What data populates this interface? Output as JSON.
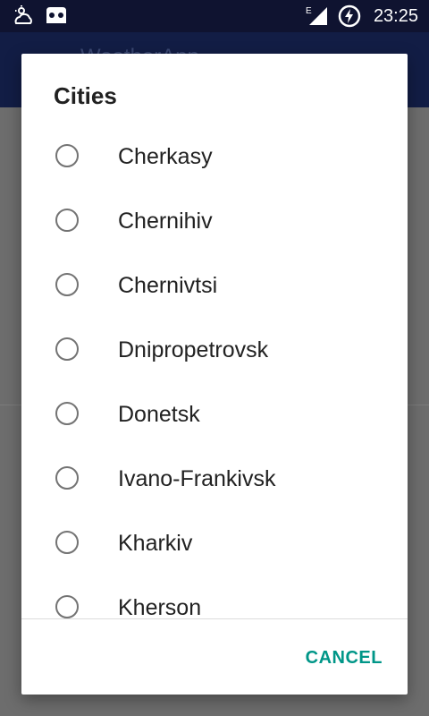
{
  "status_bar": {
    "time": "23:25",
    "network_type": "E",
    "icons": [
      "weather-alert-icon",
      "ghost-icon",
      "signal-icon",
      "battery-charging-icon"
    ]
  },
  "app_bar": {
    "title": "WeatherApp"
  },
  "dialog": {
    "title": "Cities",
    "cities": [
      {
        "label": "Cherkasy",
        "selected": false
      },
      {
        "label": "Chernihiv",
        "selected": false
      },
      {
        "label": "Chernivtsi",
        "selected": false
      },
      {
        "label": "Dnipropetrovsk",
        "selected": false
      },
      {
        "label": "Donetsk",
        "selected": false
      },
      {
        "label": "Ivano-Frankivsk",
        "selected": false
      },
      {
        "label": "Kharkiv",
        "selected": false
      },
      {
        "label": "Kherson",
        "selected": false
      }
    ],
    "cancel_label": "CANCEL"
  },
  "colors": {
    "status_bar": "#0f1330",
    "app_bar": "#121d45",
    "accent": "#009688",
    "scrim_background": "#6d6d6d"
  }
}
